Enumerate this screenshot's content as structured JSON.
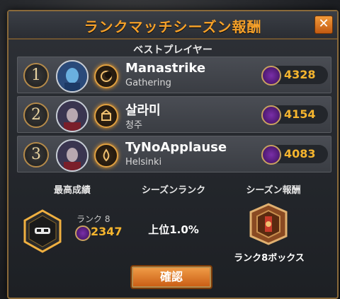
{
  "title": "ランクマッチシーズン報酬",
  "close_label": "✕",
  "best_players_heading": "ベストプレイヤー",
  "players": [
    {
      "rank": "1",
      "name": "Manastrike",
      "guild": "Gathering",
      "score": "4328"
    },
    {
      "rank": "2",
      "name": "살라미",
      "guild": "청주",
      "score": "4154"
    },
    {
      "rank": "3",
      "name": "TyNoApplause",
      "guild": "Helsinki",
      "score": "4083"
    }
  ],
  "stats": {
    "best_heading": "最高成績",
    "season_rank_heading": "シーズンランク",
    "reward_heading": "シーズン報酬",
    "best_rank_label": "ランク 8",
    "best_score": "2347",
    "season_rank_value": "上位1.0%",
    "reward_label": "ランク8ボックス"
  },
  "confirm_label": "確認",
  "colors": {
    "accent": "#f4a02a",
    "score": "#f6b52e",
    "button": "#d8702a"
  }
}
